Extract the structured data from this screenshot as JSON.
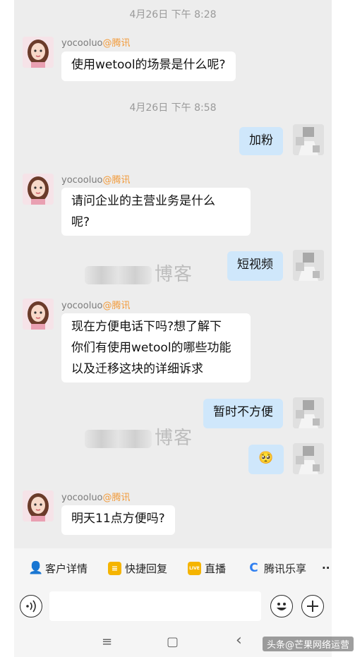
{
  "chat": {
    "time1": "4月26日 下午 8:28",
    "time2": "4月26日 下午 8:58",
    "sender_name": "yocooluo",
    "sender_org": "@腾讯",
    "messages": [
      {
        "from": "them",
        "text": "使用wetool的场景是什么呢?"
      },
      {
        "from": "me",
        "text": "加粉"
      },
      {
        "from": "them",
        "line1": "请问企业的主营业务是什么",
        "line2": "呢?"
      },
      {
        "from": "me",
        "text": "短视频"
      },
      {
        "from": "them",
        "line1": "现在方便电话下吗?想了解下",
        "line2": "你们有使用wetool的哪些功能",
        "line3": "以及迁移这块的详细诉求"
      },
      {
        "from": "me",
        "text": "暂时不方便"
      },
      {
        "from": "me",
        "text": "🥺"
      },
      {
        "from": "them",
        "text": "明天11点方便吗?"
      }
    ]
  },
  "watermark": "博客",
  "quickbar": {
    "items": [
      {
        "label": "客户详情",
        "icon": "customer-icon",
        "color": "#2aa34a"
      },
      {
        "label": "快捷回复",
        "icon": "quick-reply-icon",
        "color": "#f5b400"
      },
      {
        "label": "直播",
        "icon": "live-icon",
        "color": "#f5b400",
        "icon_text": "LIVE"
      },
      {
        "label": "腾讯乐享",
        "icon": "lexiang-icon",
        "color": "#2f7ff0"
      },
      {
        "label": "··",
        "icon": "more-icon"
      }
    ]
  },
  "nav": {
    "menu": "≡",
    "home": "▢",
    "back": "‹"
  },
  "brand": "头条@芒果网络运营"
}
